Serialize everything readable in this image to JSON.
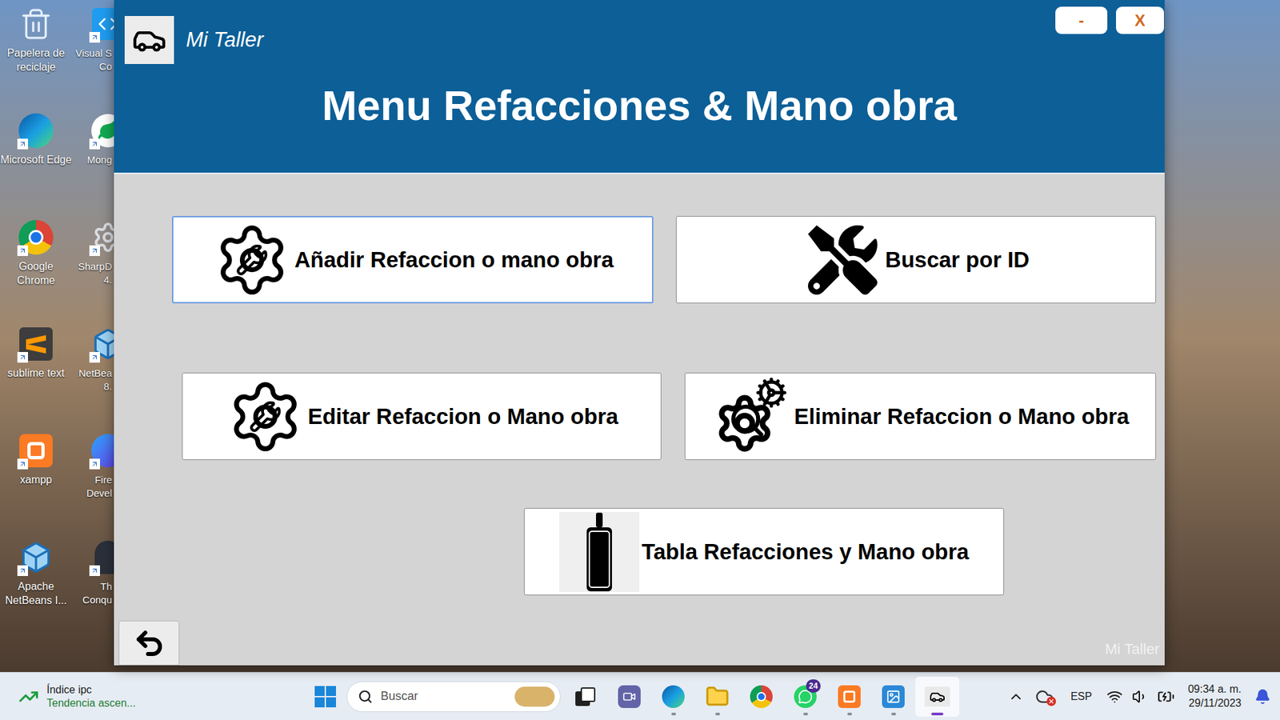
{
  "desktop": {
    "icons": [
      {
        "label": "Papelera de reciclaje",
        "kind": "recycle",
        "shortcut": false
      },
      {
        "label": "Microsoft Edge",
        "kind": "edge",
        "shortcut": true
      },
      {
        "label": "Google Chrome",
        "kind": "chrome",
        "shortcut": true
      },
      {
        "label": "sublime text",
        "kind": "sublime",
        "shortcut": true
      },
      {
        "label": "xampp",
        "kind": "xampp",
        "shortcut": true
      },
      {
        "label": "Apache NetBeans I...",
        "kind": "netbeans",
        "shortcut": true
      }
    ],
    "partial_icons": [
      {
        "label": "Visual S Co",
        "kind": "vscode",
        "shortcut": true
      },
      {
        "label": "Mong",
        "kind": "mongo",
        "shortcut": true
      },
      {
        "label": "SharpD 4.",
        "kind": "sharp",
        "shortcut": true
      },
      {
        "label": "NetBea 8.",
        "kind": "cube",
        "shortcut": true
      },
      {
        "label": "Fire Devel",
        "kind": "firefox",
        "shortcut": true
      },
      {
        "label": "Th Conqu",
        "kind": "conquer",
        "shortcut": true
      }
    ]
  },
  "window": {
    "title": "Mi Taller",
    "controls": [
      "-",
      "X"
    ],
    "heading": "Menu Refacciones & Mano obra",
    "rows": [
      [
        {
          "label": "Añadir Refaccion o mano obra",
          "kind": "add",
          "selected": true
        },
        {
          "label": "Buscar por ID",
          "kind": "search",
          "selected": false
        }
      ],
      [
        {
          "label": "Editar Refaccion o Mano obra",
          "kind": "edit",
          "selected": false
        },
        {
          "label": "Eliminar Refaccion o Mano obra",
          "kind": "delete",
          "selected": false
        }
      ],
      [
        {
          "label": "Tabla Refacciones y Mano obra",
          "kind": "table",
          "selected": false
        }
      ]
    ],
    "footer": "Mi Taller"
  },
  "taskbar": {
    "widget": {
      "title": "Índice ipc",
      "subtitle": "Tendencia ascen..."
    },
    "search": {
      "placeholder": "Buscar"
    },
    "apps": [
      {
        "kind": "task-view",
        "running": false,
        "active": false
      },
      {
        "kind": "teams",
        "running": false,
        "active": false
      },
      {
        "kind": "edge",
        "running": true,
        "active": false
      },
      {
        "kind": "explorer",
        "running": true,
        "active": false
      },
      {
        "kind": "chrome",
        "running": false,
        "active": false
      },
      {
        "kind": "whatsapp",
        "running": true,
        "active": false,
        "badge": "24"
      },
      {
        "kind": "xampp",
        "running": true,
        "active": false
      },
      {
        "kind": "photos",
        "running": true,
        "active": false
      },
      {
        "kind": "mi-taller",
        "running": true,
        "active": true
      }
    ],
    "language": "ESP",
    "time": "09:34 a. m.",
    "date": "29/11/2023"
  }
}
